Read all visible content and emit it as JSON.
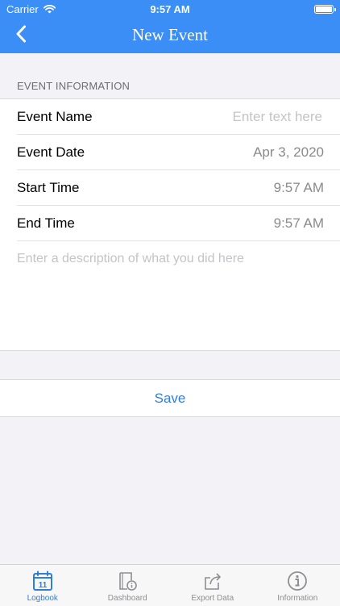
{
  "status_bar": {
    "carrier": "Carrier",
    "time": "9:57 AM"
  },
  "nav": {
    "title": "New Event"
  },
  "form": {
    "section_header": "EVENT INFORMATION",
    "event_name": {
      "label": "Event Name",
      "value": "",
      "placeholder": "Enter text here"
    },
    "event_date": {
      "label": "Event Date",
      "value": "Apr 3, 2020"
    },
    "start_time": {
      "label": "Start Time",
      "value": "9:57 AM"
    },
    "end_time": {
      "label": "End Time",
      "value": "9:57 AM"
    },
    "description": {
      "value": "",
      "placeholder": "Enter a description of what you did here"
    }
  },
  "actions": {
    "save_label": "Save"
  },
  "tabs": [
    {
      "label": "Logbook",
      "icon": "calendar-icon",
      "active": true,
      "icon_text": "11"
    },
    {
      "label": "Dashboard",
      "icon": "dashboard-icon",
      "active": false
    },
    {
      "label": "Export Data",
      "icon": "export-icon",
      "active": false
    },
    {
      "label": "Information",
      "icon": "info-icon",
      "active": false
    }
  ],
  "colors": {
    "header": "#3a8ef6",
    "accent": "#2f7fd8",
    "background": "#f2f2f7",
    "inactive_tab": "#8e8e93"
  }
}
